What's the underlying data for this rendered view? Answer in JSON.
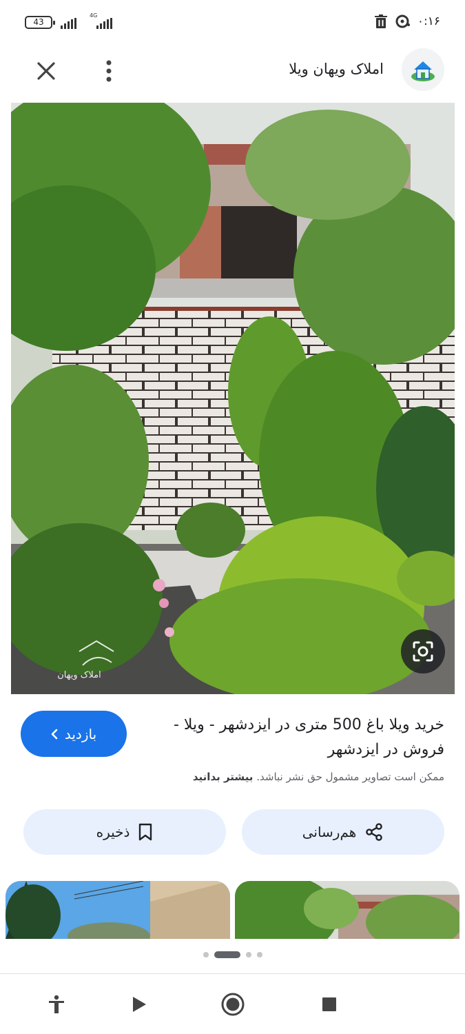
{
  "status_bar": {
    "battery": "43",
    "network": "4G",
    "time": "۰:۱۶"
  },
  "header": {
    "site_name": "املاک ویهان ویلا"
  },
  "image": {
    "watermark": "املاک ویهان"
  },
  "result": {
    "title": "خرید ویلا باغ 500 متری در ایزدشهر - ویلا - فروش در ایزدشهر",
    "visit_label": "بازدید",
    "copyright_text": "ممکن است تصاویر مشمول حق نشر نباشد.",
    "learn_more": "بیشتر بدانید"
  },
  "actions": {
    "share_label": "هم‌رسانی",
    "save_label": "ذخیره"
  },
  "icons": {
    "close": "close-icon",
    "more": "more-vert-icon",
    "lens": "lens-icon",
    "share": "share-icon",
    "bookmark": "bookmark-icon"
  },
  "colors": {
    "accent": "#1a73e8",
    "action_bg": "#e8f0fe"
  }
}
